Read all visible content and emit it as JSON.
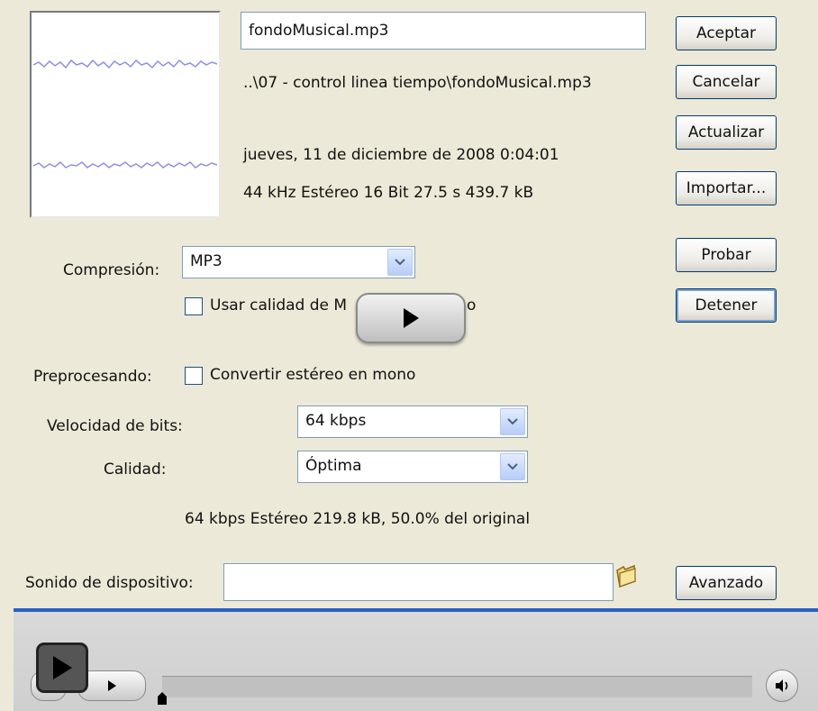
{
  "file": {
    "name": "fondoMusical.mp3",
    "path": "..\\07 - control linea tiempo\\fondoMusical.mp3",
    "date": "jueves, 11 de diciembre de 2008  0:04:01",
    "info": "44 kHz Estéreo 16 Bit 27.5 s 439.7 kB"
  },
  "buttons": {
    "accept": "Aceptar",
    "cancel": "Cancelar",
    "update": "Actualizar",
    "import": "Importar...",
    "test": "Probar",
    "stop": "Detener",
    "advanced": "Avanzado"
  },
  "compression": {
    "label": "Compresión:",
    "value": "MP3"
  },
  "quality_checkbox": {
    "label": "Usar calidad de M",
    "label_tail": "o",
    "checked": false
  },
  "preprocessing": {
    "label": "Preprocesando:",
    "checkbox_label": "Convertir estéreo en mono",
    "checked": false
  },
  "bitrate": {
    "label": "Velocidad de bits:",
    "value": "64 kbps"
  },
  "quality": {
    "label": "Calidad:",
    "value": "Óptima"
  },
  "summary": "64 kbps  Estéreo 219.8 kB, 50.0% del original",
  "device_sound": {
    "label": "Sonido de dispositivo:",
    "value": ""
  },
  "icons": {
    "overlay": "play-icon",
    "folder": "folder-icon",
    "volume": "speaker-icon"
  },
  "colors": {
    "accent": "#2b5fc7",
    "wave": "#8f8fe3",
    "panel": "#ece9d8"
  }
}
